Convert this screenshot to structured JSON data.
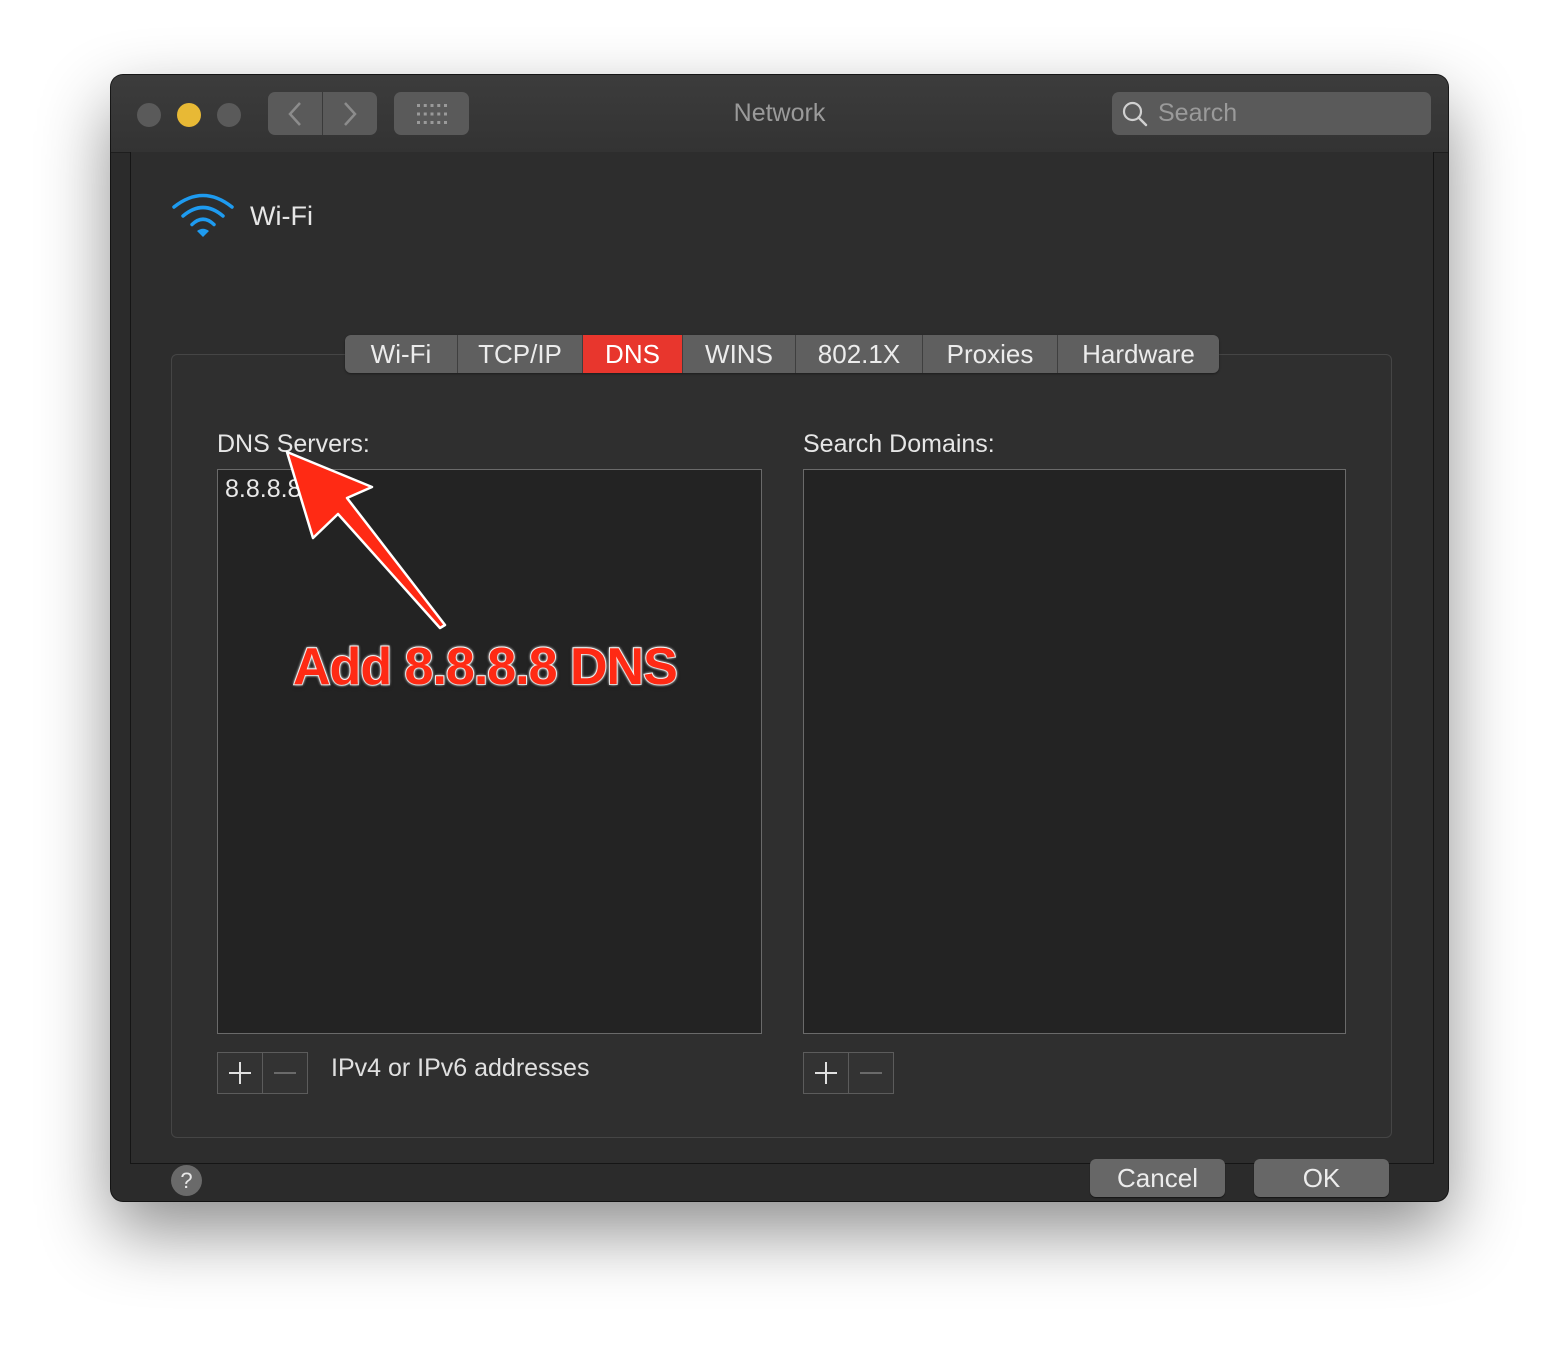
{
  "window": {
    "title": "Network",
    "search_placeholder": "Search"
  },
  "interface": {
    "name": "Wi-Fi"
  },
  "tabs": [
    {
      "label": "Wi-Fi",
      "active": false
    },
    {
      "label": "TCP/IP",
      "active": false
    },
    {
      "label": "DNS",
      "active": true
    },
    {
      "label": "WINS",
      "active": false
    },
    {
      "label": "802.1X",
      "active": false
    },
    {
      "label": "Proxies",
      "active": false
    },
    {
      "label": "Hardware",
      "active": false
    }
  ],
  "dns": {
    "servers_label": "DNS Servers:",
    "servers": [
      "8.8.8.8"
    ],
    "hint": "IPv4 or IPv6 addresses",
    "search_domains_label": "Search Domains:",
    "search_domains": []
  },
  "buttons": {
    "help": "?",
    "cancel": "Cancel",
    "ok": "OK"
  },
  "annotation": {
    "text": "Add 8.8.8.8 DNS",
    "color": "#ff2a14"
  },
  "colors": {
    "active_tab": "#e8362d",
    "minimize": "#e8b935",
    "wifi_icon": "#1e9bf0"
  },
  "icons": {
    "back": "chevron-left-icon",
    "forward": "chevron-right-icon",
    "show_all": "grid-icon",
    "search": "magnifier-icon",
    "wifi": "wifi-icon",
    "add": "plus-icon",
    "remove": "minus-icon",
    "help": "question-icon"
  }
}
